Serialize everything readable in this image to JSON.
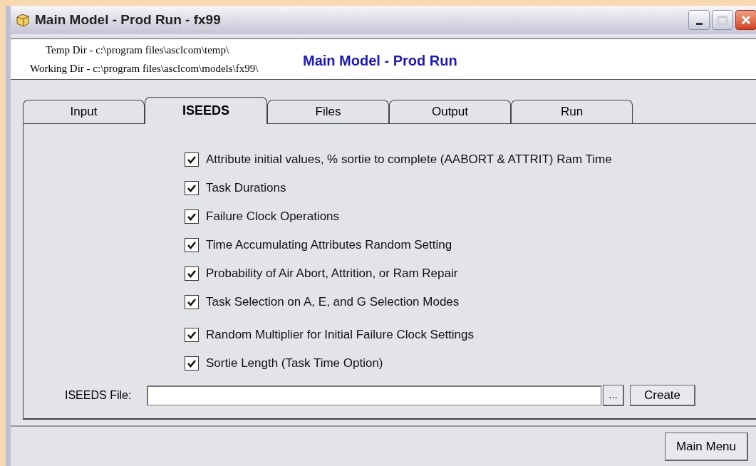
{
  "window": {
    "title": "Main Model - Prod Run - fx99"
  },
  "header": {
    "temp_dir": "Temp Dir - c:\\program files\\asclcom\\temp\\",
    "working_dir": "Working Dir - c:\\program files\\asclcom\\models\\fx99\\",
    "heading": "Main Model - Prod Run"
  },
  "tabs": [
    {
      "label": "Input",
      "selected": false
    },
    {
      "label": "ISEEDS",
      "selected": true
    },
    {
      "label": "Files",
      "selected": false
    },
    {
      "label": "Output",
      "selected": false
    },
    {
      "label": "Run",
      "selected": false
    }
  ],
  "options": [
    {
      "label": "Attribute initial values, % sortie to complete (AABORT & ATTRIT) Ram Time",
      "checked": true
    },
    {
      "label": "Task Durations",
      "checked": true
    },
    {
      "label": "Failure Clock Operations",
      "checked": true
    },
    {
      "label": "Time Accumulating Attributes Random Setting",
      "checked": true
    },
    {
      "label": "Probability of Air Abort, Attrition, or Ram Repair",
      "checked": true
    },
    {
      "label": "Task Selection on A, E, and G Selection Modes",
      "checked": true
    },
    {
      "label": "Random Multiplier for Initial Failure Clock Settings",
      "checked": true
    },
    {
      "label": "Sortie Length (Task Time Option)",
      "checked": true
    }
  ],
  "iseeds_file": {
    "label": "ISEEDS File:",
    "browse": "...",
    "create": {
      "label": "Create"
    }
  },
  "main_menu": {
    "label": "Main Menu"
  }
}
